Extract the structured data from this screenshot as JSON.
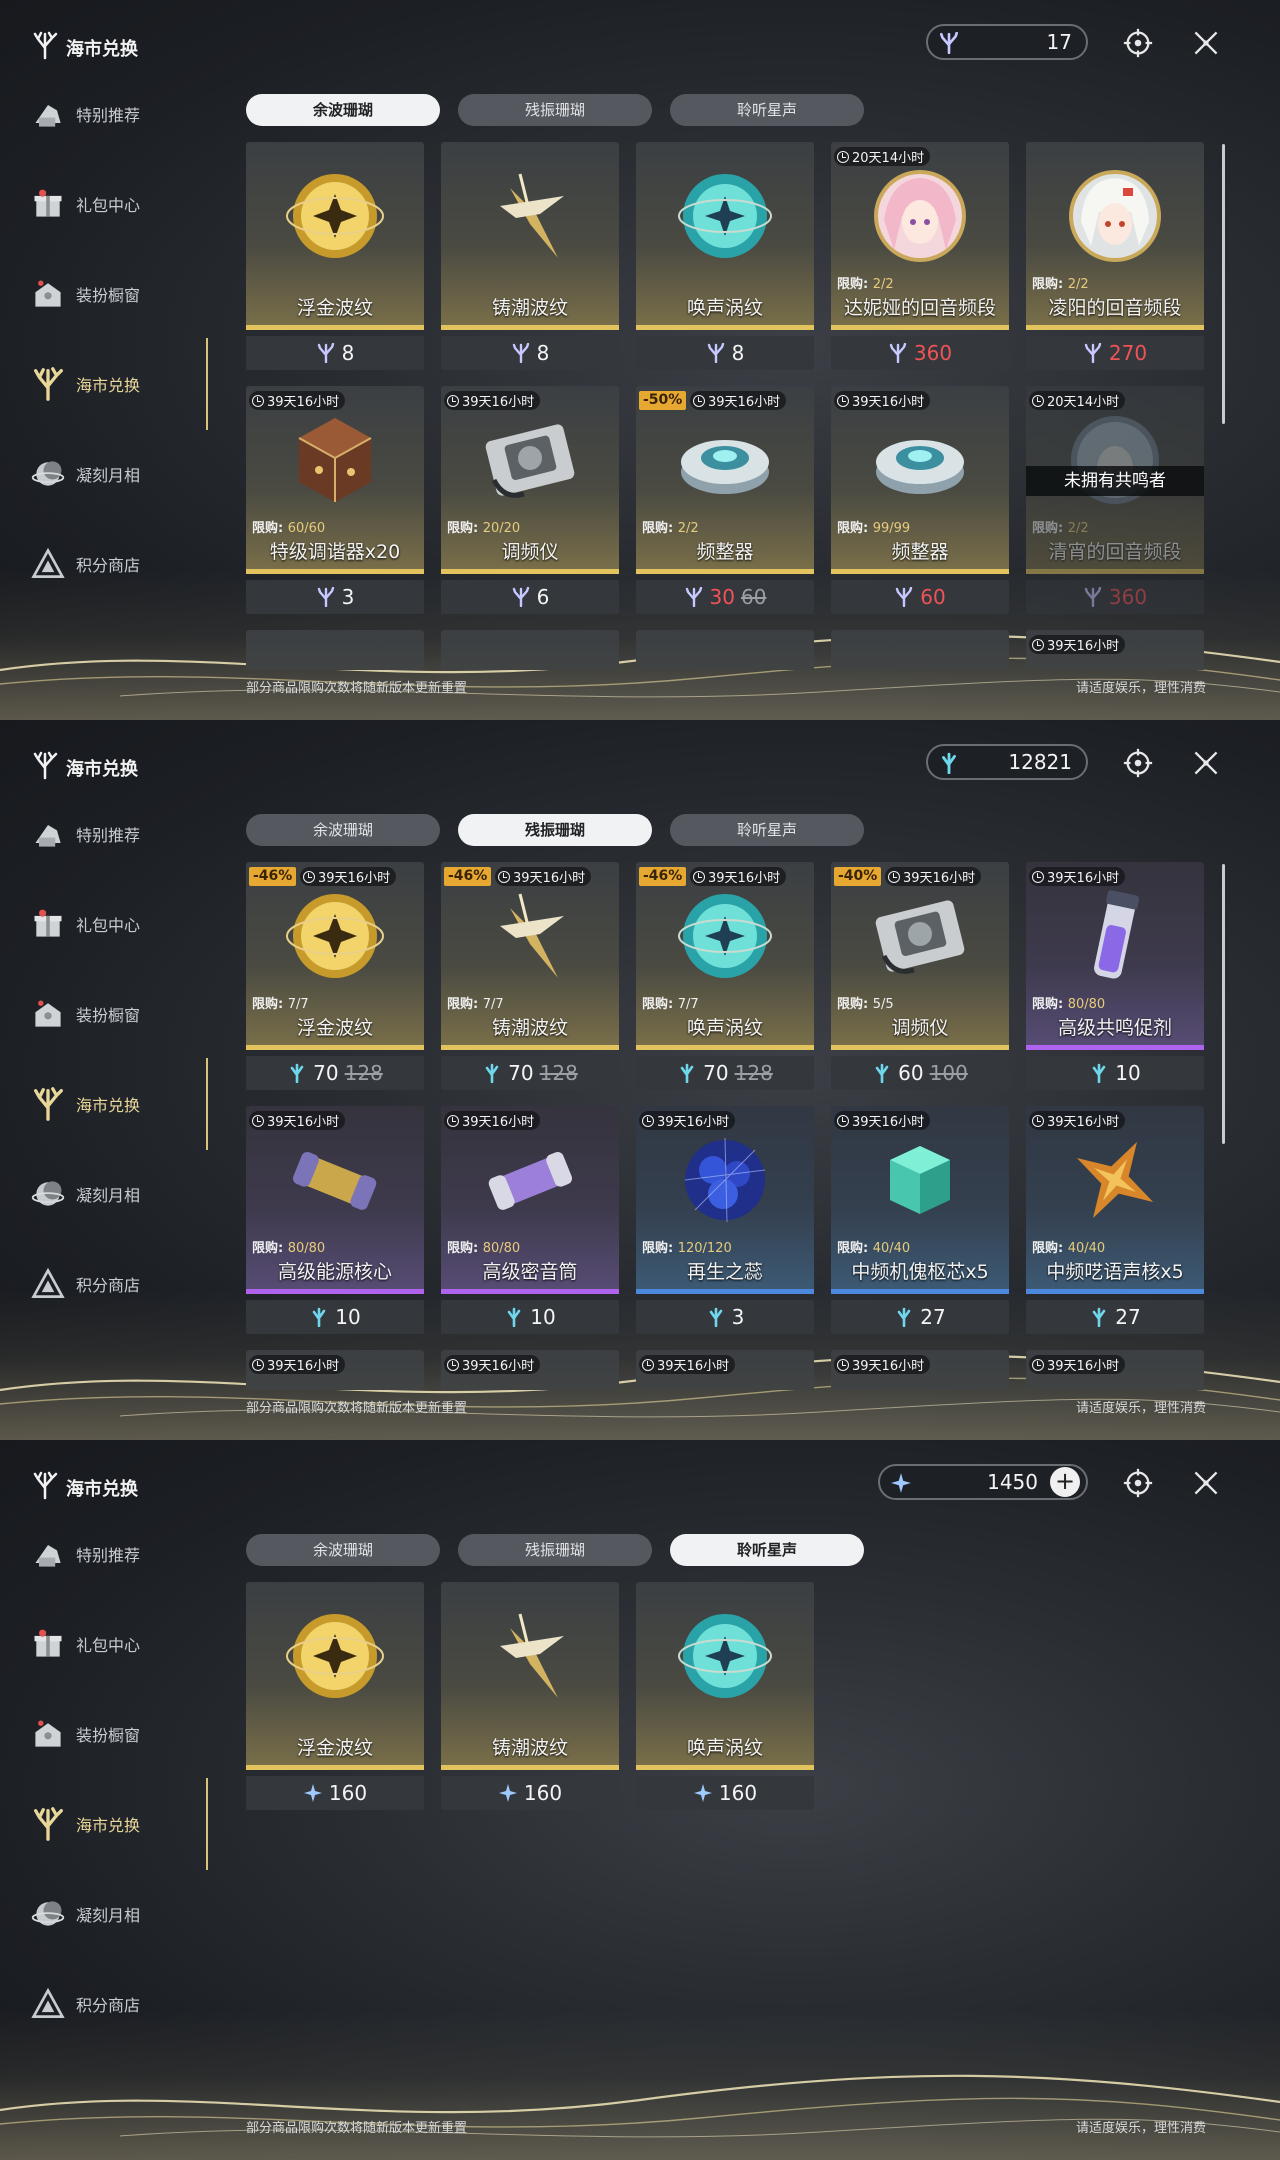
{
  "panels": [
    {
      "title": "海市兑换",
      "sidebar": [
        {
          "label": "特别推荐",
          "icon": "featured-icon"
        },
        {
          "label": "礼包中心",
          "icon": "gift-icon"
        },
        {
          "label": "装扮橱窗",
          "icon": "wardrobe-icon"
        },
        {
          "label": "海市兑换",
          "icon": "coral-exchange-icon",
          "active": true
        },
        {
          "label": "凝刻月相",
          "icon": "moon-phase-icon"
        },
        {
          "label": "积分商店",
          "icon": "points-shop-icon"
        }
      ],
      "currency": {
        "amount": "17",
        "icon": "afterglow-coral-icon",
        "plus": ""
      },
      "tabs": [
        "余波珊瑚",
        "残振珊瑚",
        "聆听星声"
      ],
      "active_tab": 0,
      "footer_left": "部分商品限购次数将随新版本更新重置",
      "footer_right": "请适度娱乐，理性消费",
      "items": [
        {
          "name": "浮金波纹",
          "img": "gold-ripple-orb-icon",
          "rarity": "gold",
          "price": "8"
        },
        {
          "name": "铸潮波纹",
          "img": "tide-blade-icon",
          "rarity": "gold",
          "price": "8"
        },
        {
          "name": "唤声涡纹",
          "img": "cyan-vortex-orb-icon",
          "rarity": "gold",
          "price": "8"
        },
        {
          "name": "达妮娅的回音频段",
          "img": "pink-hair-portrait-icon",
          "rarity": "gold",
          "timer": "20天14小时",
          "limit_label": "限购:",
          "limit": "2/2",
          "price": "360",
          "price_red": true
        },
        {
          "name": "凌阳的回音频段",
          "img": "white-hair-portrait-icon",
          "rarity": "gold",
          "limit_label": "限购:",
          "limit": "2/2",
          "price": "270",
          "price_red": true
        },
        {
          "name": "特级调谐器x20",
          "img": "tuner-dice-icon",
          "rarity": "gold",
          "timer": "39天16小时",
          "limit_label": "限购:",
          "limit": "60/60",
          "price": "3"
        },
        {
          "name": "调频仪",
          "img": "radio-device-icon",
          "rarity": "gold",
          "timer": "39天16小时",
          "limit_label": "限购:",
          "limit": "20/20",
          "price": "6"
        },
        {
          "name": "频整器",
          "img": "frequency-disc-icon",
          "rarity": "gold",
          "timer": "39天16小时",
          "discount": "-50%",
          "limit_label": "限购:",
          "limit": "2/2",
          "price": "30",
          "old_price": "60",
          "price_red": true
        },
        {
          "name": "频整器",
          "img": "frequency-disc-icon",
          "rarity": "gold",
          "timer": "39天16小时",
          "limit_label": "限购:",
          "limit": "99/99",
          "price": "60",
          "price_red": true
        },
        {
          "name": "清宵的回音频段",
          "img": "portrait-dim-icon",
          "rarity": "gold",
          "timer": "20天14小时",
          "limit_label": "限购:",
          "limit": "2/2",
          "price": "360",
          "price_red": true,
          "dim": true,
          "overlay": "未拥有共鸣者"
        },
        {
          "name": "",
          "img": "",
          "rarity": "gold"
        },
        {
          "name": "",
          "img": "",
          "rarity": "gold"
        },
        {
          "name": "",
          "img": "",
          "rarity": "gold"
        },
        {
          "name": "",
          "img": "",
          "rarity": "gold"
        },
        {
          "name": "",
          "img": "",
          "rarity": "gold",
          "timer": "39天16小时"
        }
      ]
    },
    {
      "title": "海市兑换",
      "sidebar": [
        {
          "label": "特别推荐",
          "icon": "featured-icon"
        },
        {
          "label": "礼包中心",
          "icon": "gift-icon"
        },
        {
          "label": "装扮橱窗",
          "icon": "wardrobe-icon"
        },
        {
          "label": "海市兑换",
          "icon": "coral-exchange-icon",
          "active": true
        },
        {
          "label": "凝刻月相",
          "icon": "moon-phase-icon"
        },
        {
          "label": "积分商店",
          "icon": "points-shop-icon"
        }
      ],
      "currency": {
        "amount": "12821",
        "icon": "oscillate-coral-icon",
        "plus": ""
      },
      "tabs": [
        "余波珊瑚",
        "残振珊瑚",
        "聆听星声"
      ],
      "active_tab": 1,
      "footer_left": "部分商品限购次数将随新版本更新重置",
      "footer_right": "请适度娱乐，理性消费",
      "items": [
        {
          "name": "浮金波纹",
          "img": "gold-ripple-orb-icon",
          "rarity": "gold",
          "discount": "-46%",
          "timer": "39天16小时",
          "limit_label": "限购:",
          "limit": "7/7",
          "limit_white": true,
          "price": "70",
          "old_price": "128"
        },
        {
          "name": "铸潮波纹",
          "img": "tide-blade-icon",
          "rarity": "gold",
          "discount": "-46%",
          "timer": "39天16小时",
          "limit_label": "限购:",
          "limit": "7/7",
          "limit_white": true,
          "price": "70",
          "old_price": "128"
        },
        {
          "name": "唤声涡纹",
          "img": "cyan-vortex-orb-icon",
          "rarity": "gold",
          "discount": "-46%",
          "timer": "39天16小时",
          "limit_label": "限购:",
          "limit": "7/7",
          "limit_white": true,
          "price": "70",
          "old_price": "128"
        },
        {
          "name": "调频仪",
          "img": "radio-device-icon",
          "rarity": "gold",
          "discount": "-40%",
          "timer": "39天16小时",
          "limit_label": "限购:",
          "limit": "5/5",
          "limit_white": true,
          "price": "60",
          "old_price": "100"
        },
        {
          "name": "高级共鸣促剂",
          "img": "resonance-potion-icon",
          "rarity": "purple",
          "timer": "39天16小时",
          "limit_label": "限购:",
          "limit": "80/80",
          "price": "10"
        },
        {
          "name": "高级能源核心",
          "img": "energy-core-icon",
          "rarity": "purple",
          "timer": "39天16小时",
          "limit_label": "限购:",
          "limit": "80/80",
          "price": "10"
        },
        {
          "name": "高级密音筒",
          "img": "sealed-tube-icon",
          "rarity": "purple",
          "timer": "39天16小时",
          "limit_label": "限购:",
          "limit": "80/80",
          "price": "10"
        },
        {
          "name": "再生之蕊",
          "img": "regen-crystal-icon",
          "rarity": "blue",
          "timer": "39天16小时",
          "limit_label": "限购:",
          "limit": "120/120",
          "price": "3"
        },
        {
          "name": "中频机傀枢芯x5",
          "img": "green-cube-icon",
          "rarity": "blue",
          "timer": "39天16小时",
          "limit_label": "限购:",
          "limit": "40/40",
          "price": "27"
        },
        {
          "name": "中频呓语声核x5",
          "img": "orange-star-icon",
          "rarity": "blue",
          "timer": "39天16小时",
          "limit_label": "限购:",
          "limit": "40/40",
          "price": "27"
        },
        {
          "name": "",
          "img": "",
          "rarity": "gold",
          "timer": "39天16小时"
        },
        {
          "name": "",
          "img": "",
          "rarity": "gold",
          "timer": "39天16小时"
        },
        {
          "name": "",
          "img": "",
          "rarity": "gold",
          "timer": "39天16小时"
        },
        {
          "name": "",
          "img": "",
          "rarity": "gold",
          "timer": "39天16小时"
        },
        {
          "name": "",
          "img": "",
          "rarity": "gold",
          "timer": "39天16小时"
        }
      ]
    },
    {
      "title": "海市兑换",
      "sidebar": [
        {
          "label": "特别推荐",
          "icon": "featured-icon"
        },
        {
          "label": "礼包中心",
          "icon": "gift-icon"
        },
        {
          "label": "装扮橱窗",
          "icon": "wardrobe-icon"
        },
        {
          "label": "海市兑换",
          "icon": "coral-exchange-icon",
          "active": true
        },
        {
          "label": "凝刻月相",
          "icon": "moon-phase-icon"
        },
        {
          "label": "积分商店",
          "icon": "points-shop-icon"
        }
      ],
      "currency": {
        "amount": "1450",
        "icon": "star-sound-icon",
        "plus": "+"
      },
      "tabs": [
        "余波珊瑚",
        "残振珊瑚",
        "聆听星声"
      ],
      "active_tab": 2,
      "footer_left": "部分商品限购次数将随新版本更新重置",
      "footer_right": "请适度娱乐，理性消费",
      "items": [
        {
          "name": "浮金波纹",
          "img": "gold-ripple-orb-icon",
          "rarity": "gold",
          "price": "160"
        },
        {
          "name": "铸潮波纹",
          "img": "tide-blade-icon",
          "rarity": "gold",
          "price": "160"
        },
        {
          "name": "唤声涡纹",
          "img": "cyan-vortex-orb-icon",
          "rarity": "gold",
          "price": "160"
        }
      ]
    }
  ],
  "colors": {
    "accent": "#d9c47f",
    "discount": "#e7a832",
    "price_red": "#f05356",
    "gold": "#e3c35e",
    "purple": "#b063ee",
    "blue": "#4d88df"
  }
}
